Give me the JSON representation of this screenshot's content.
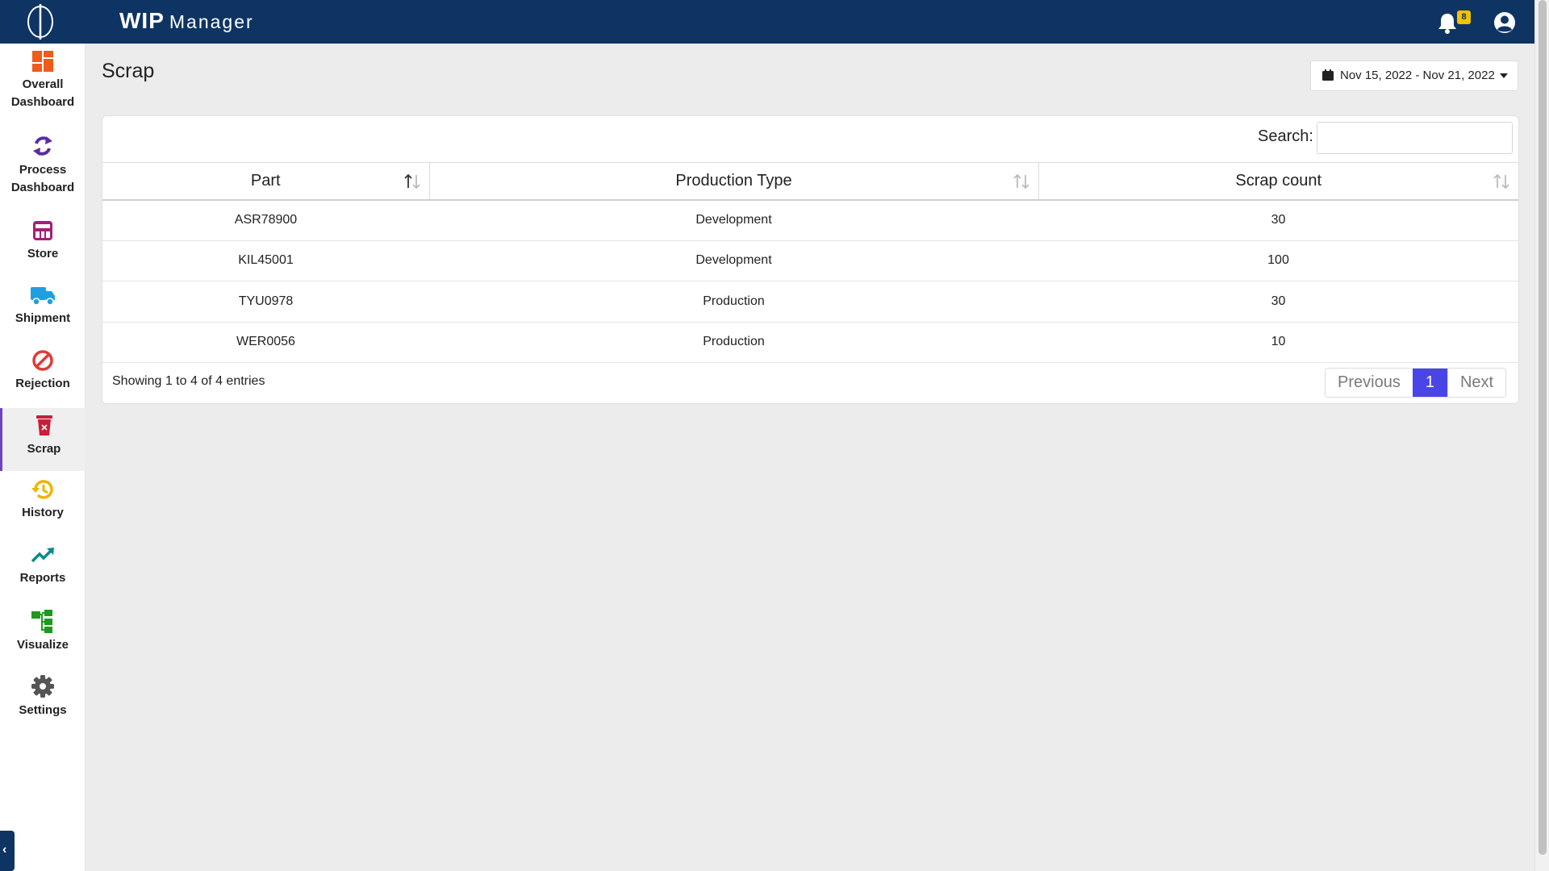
{
  "app": {
    "title_bold": "WIP",
    "title_rest": "Manager",
    "notification_count": "8"
  },
  "sidebar": {
    "items": [
      {
        "label1": "Overall",
        "label2": "Dashboard",
        "icon": "dashboard-icon",
        "color": "#f05a1a"
      },
      {
        "label1": "Process",
        "label2": "Dashboard",
        "icon": "process-cycle-icon",
        "color": "#5b2ca0"
      },
      {
        "label1": "Store",
        "icon": "store-icon",
        "color": "#a0207a"
      },
      {
        "label1": "Shipment",
        "icon": "truck-icon",
        "color": "#1ea0e0"
      },
      {
        "label1": "Rejection",
        "icon": "ban-icon",
        "color": "#e03b3b"
      },
      {
        "label1": "Scrap",
        "icon": "scrap-bin-icon",
        "color": "#c81e3a",
        "active": true
      },
      {
        "label1": "History",
        "icon": "history-icon",
        "color": "#f0b400"
      },
      {
        "label1": "Reports",
        "icon": "trend-up-icon",
        "color": "#0d8a8a"
      },
      {
        "label1": "Visualize",
        "icon": "hierarchy-icon",
        "color": "#1e9a1e"
      },
      {
        "label1": "Settings",
        "icon": "gear-icon",
        "color": "#555555"
      }
    ]
  },
  "page": {
    "title": "Scrap",
    "date_range": "Nov 15, 2022 - Nov 21, 2022"
  },
  "table": {
    "search_label": "Search:",
    "search_value": "",
    "columns": [
      "Part",
      "Production Type",
      "Scrap count"
    ],
    "rows": [
      [
        "ASR78900",
        "Development",
        "30"
      ],
      [
        "KIL45001",
        "Development",
        "100"
      ],
      [
        "TYU0978",
        "Production",
        "30"
      ],
      [
        "WER0056",
        "Production",
        "10"
      ]
    ],
    "info": "Showing 1 to 4 of 4 entries",
    "pagination": {
      "previous": "Previous",
      "current": "1",
      "next": "Next"
    }
  }
}
